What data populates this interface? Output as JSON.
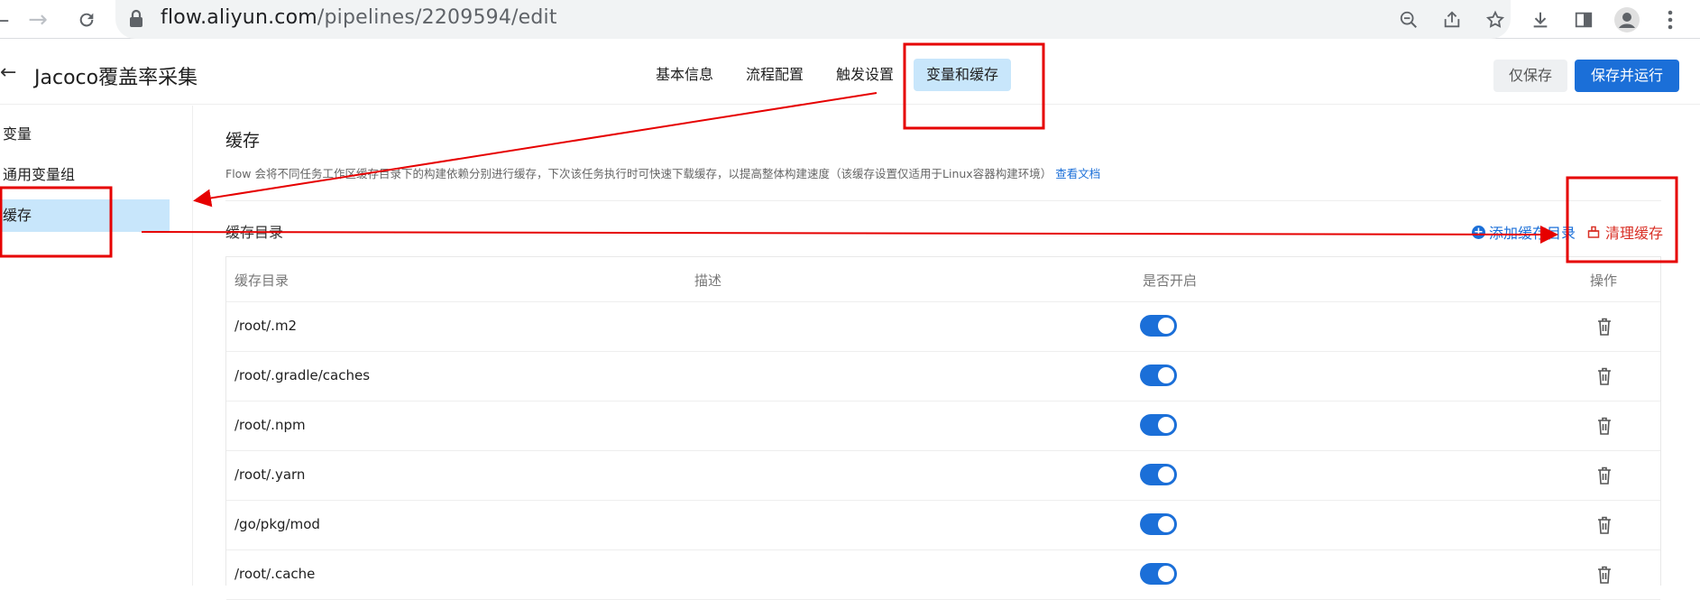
{
  "browser": {
    "url_host": "flow.aliyun.com",
    "url_path": "/pipelines/2209594/edit"
  },
  "header": {
    "title": "Jacoco覆盖率采集",
    "tabs": [
      {
        "label": "基本信息",
        "active": false
      },
      {
        "label": "流程配置",
        "active": false
      },
      {
        "label": "触发设置",
        "active": false
      },
      {
        "label": "变量和缓存",
        "active": true
      }
    ],
    "save_label": "仅保存",
    "save_run_label": "保存并运行"
  },
  "sidebar": {
    "items": [
      {
        "label": "变量",
        "active": false
      },
      {
        "label": "通用变量组",
        "active": false
      },
      {
        "label": "缓存",
        "active": true
      }
    ]
  },
  "main": {
    "title": "缓存",
    "description": "Flow 会将不同任务工作区缓存目录下的构建依赖分别进行缓存，下次该任务执行时可快速下载缓存，以提高整体构建速度（该缓存设置仅适用于Linux容器构建环境）",
    "doc_link": "查看文档",
    "cache_dir_label": "缓存目录",
    "add_dir_label": "添加缓存目录",
    "clear_cache_label": "清理缓存",
    "table": {
      "headers": [
        "缓存目录",
        "描述",
        "是否开启",
        "操作"
      ],
      "rows": [
        {
          "path": "/root/.m2",
          "desc": "",
          "enabled": true
        },
        {
          "path": "/root/.gradle/caches",
          "desc": "",
          "enabled": true
        },
        {
          "path": "/root/.npm",
          "desc": "",
          "enabled": true
        },
        {
          "path": "/root/.yarn",
          "desc": "",
          "enabled": true
        },
        {
          "path": "/go/pkg/mod",
          "desc": "",
          "enabled": true
        },
        {
          "path": "/root/.cache",
          "desc": "",
          "enabled": true
        }
      ]
    }
  },
  "colors": {
    "accent": "#1b6fd8",
    "active_tab_bg": "#c8e6fb",
    "danger": "#d93026",
    "annotation": "#e60000"
  }
}
